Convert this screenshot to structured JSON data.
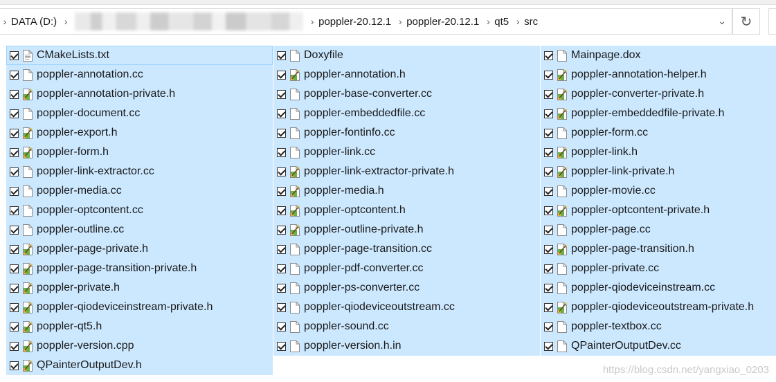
{
  "breadcrumb": {
    "segments": [
      "DATA (D:)",
      "poppler-20.12.1",
      "poppler-20.12.1",
      "qt5",
      "src"
    ]
  },
  "colors": {
    "selection": "#cce8ff",
    "focus_border": "#99d1ff"
  },
  "files": [
    {
      "name": "CMakeLists.txt",
      "icon": "text-file-icon"
    },
    {
      "name": "poppler-annotation.cc",
      "icon": "blank-file-icon"
    },
    {
      "name": "poppler-annotation-private.h",
      "icon": "header-file-icon"
    },
    {
      "name": "poppler-document.cc",
      "icon": "blank-file-icon"
    },
    {
      "name": "poppler-export.h",
      "icon": "header-file-icon"
    },
    {
      "name": "poppler-form.h",
      "icon": "header-file-icon"
    },
    {
      "name": "poppler-link-extractor.cc",
      "icon": "blank-file-icon"
    },
    {
      "name": "poppler-media.cc",
      "icon": "blank-file-icon"
    },
    {
      "name": "poppler-optcontent.cc",
      "icon": "blank-file-icon"
    },
    {
      "name": "poppler-outline.cc",
      "icon": "blank-file-icon"
    },
    {
      "name": "poppler-page-private.h",
      "icon": "header-file-icon"
    },
    {
      "name": "poppler-page-transition-private.h",
      "icon": "header-file-icon"
    },
    {
      "name": "poppler-private.h",
      "icon": "header-file-icon"
    },
    {
      "name": "poppler-qiodeviceinstream-private.h",
      "icon": "header-file-icon"
    },
    {
      "name": "poppler-qt5.h",
      "icon": "header-file-icon"
    },
    {
      "name": "poppler-version.cpp",
      "icon": "header-file-icon"
    },
    {
      "name": "QPainterOutputDev.h",
      "icon": "header-file-icon"
    },
    {
      "name": "Doxyfile",
      "icon": "blank-file-icon"
    },
    {
      "name": "poppler-annotation.h",
      "icon": "header-file-icon"
    },
    {
      "name": "poppler-base-converter.cc",
      "icon": "blank-file-icon"
    },
    {
      "name": "poppler-embeddedfile.cc",
      "icon": "blank-file-icon"
    },
    {
      "name": "poppler-fontinfo.cc",
      "icon": "blank-file-icon"
    },
    {
      "name": "poppler-link.cc",
      "icon": "blank-file-icon"
    },
    {
      "name": "poppler-link-extractor-private.h",
      "icon": "header-file-icon"
    },
    {
      "name": "poppler-media.h",
      "icon": "header-file-icon"
    },
    {
      "name": "poppler-optcontent.h",
      "icon": "header-file-icon"
    },
    {
      "name": "poppler-outline-private.h",
      "icon": "header-file-icon"
    },
    {
      "name": "poppler-page-transition.cc",
      "icon": "blank-file-icon"
    },
    {
      "name": "poppler-pdf-converter.cc",
      "icon": "blank-file-icon"
    },
    {
      "name": "poppler-ps-converter.cc",
      "icon": "blank-file-icon"
    },
    {
      "name": "poppler-qiodeviceoutstream.cc",
      "icon": "blank-file-icon"
    },
    {
      "name": "poppler-sound.cc",
      "icon": "blank-file-icon"
    },
    {
      "name": "poppler-version.h.in",
      "icon": "blank-file-icon"
    },
    {
      "name": "Mainpage.dox",
      "icon": "blank-file-icon"
    },
    {
      "name": "poppler-annotation-helper.h",
      "icon": "header-file-icon"
    },
    {
      "name": "poppler-converter-private.h",
      "icon": "header-file-icon"
    },
    {
      "name": "poppler-embeddedfile-private.h",
      "icon": "header-file-icon"
    },
    {
      "name": "poppler-form.cc",
      "icon": "blank-file-icon"
    },
    {
      "name": "poppler-link.h",
      "icon": "header-file-icon"
    },
    {
      "name": "poppler-link-private.h",
      "icon": "header-file-icon"
    },
    {
      "name": "poppler-movie.cc",
      "icon": "blank-file-icon"
    },
    {
      "name": "poppler-optcontent-private.h",
      "icon": "header-file-icon"
    },
    {
      "name": "poppler-page.cc",
      "icon": "blank-file-icon"
    },
    {
      "name": "poppler-page-transition.h",
      "icon": "header-file-icon"
    },
    {
      "name": "poppler-private.cc",
      "icon": "blank-file-icon"
    },
    {
      "name": "poppler-qiodeviceinstream.cc",
      "icon": "blank-file-icon"
    },
    {
      "name": "poppler-qiodeviceoutstream-private.h",
      "icon": "header-file-icon"
    },
    {
      "name": "poppler-textbox.cc",
      "icon": "blank-file-icon"
    },
    {
      "name": "QPainterOutputDev.cc",
      "icon": "blank-file-icon"
    }
  ],
  "columns": [
    17,
    16,
    16
  ],
  "watermark": "https://blog.csdn.net/yangxiao_0203"
}
